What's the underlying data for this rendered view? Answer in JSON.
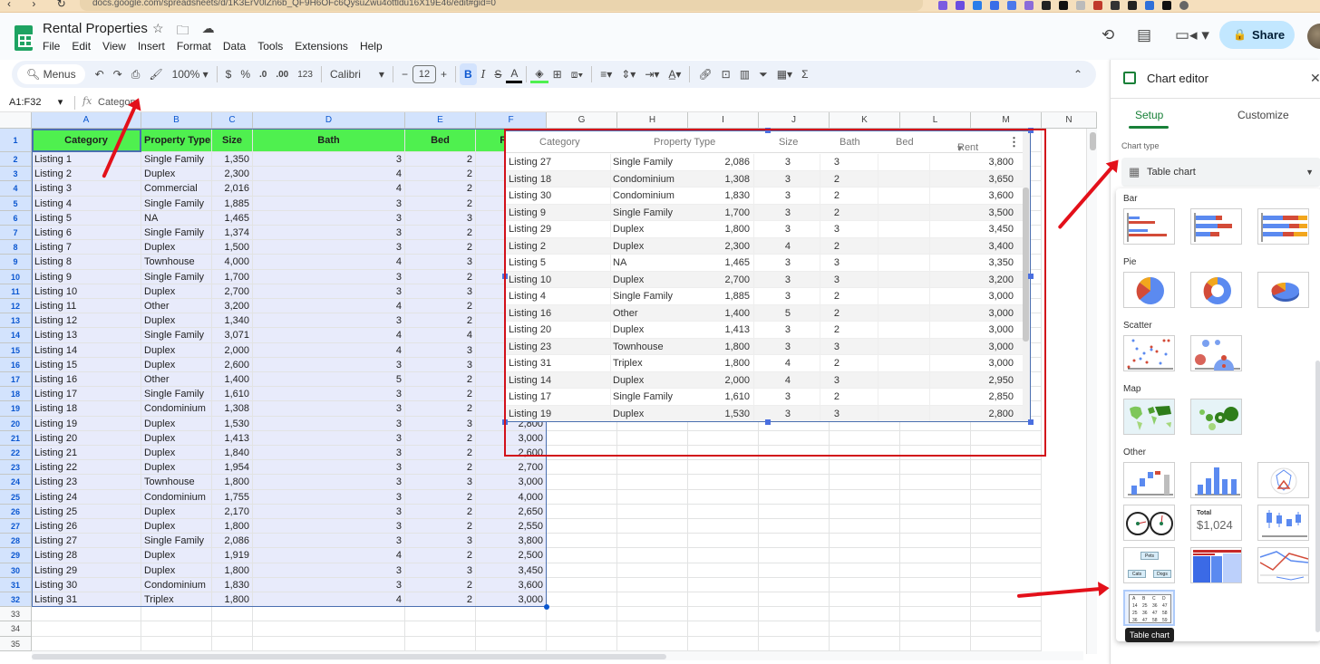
{
  "browser": {
    "url": "docs.google.com/spreadsheets/d/1K3ErV0lZn6b_QF9H6OFc6QysuZwu4ottldu16X19E46/edit#gid=0"
  },
  "app": {
    "title": "Rental Properties",
    "menu": [
      "File",
      "Edit",
      "View",
      "Insert",
      "Format",
      "Data",
      "Tools",
      "Extensions",
      "Help"
    ],
    "share_label": "Share"
  },
  "toolbar": {
    "search_label": "Menus",
    "zoom": "100%",
    "currency": "$",
    "percent": "%",
    "decrease_decimal": ".0",
    "increase_decimal": ".00",
    "number_format": "123",
    "font": "Calibri",
    "font_size": "12",
    "minus": "−",
    "plus": "+",
    "bold": "B",
    "italic": "I",
    "text_color": "A",
    "sum": "Σ"
  },
  "formula_bar": {
    "range": "A1:F32",
    "fx": "fx",
    "value": "Category"
  },
  "sheet": {
    "columns": [
      "A",
      "B",
      "C",
      "D",
      "E",
      "F",
      "G",
      "H",
      "I",
      "J",
      "K",
      "L",
      "M",
      "N"
    ],
    "headers": [
      "Category",
      "Property Type",
      "Size",
      "Bath",
      "Bed",
      "Rent"
    ],
    "rows": [
      [
        "Listing 1",
        "Single Family",
        "1,350",
        "3",
        "2",
        ""
      ],
      [
        "Listing 2",
        "Duplex",
        "2,300",
        "4",
        "2",
        ""
      ],
      [
        "Listing 3",
        "Commercial",
        "2,016",
        "4",
        "2",
        ""
      ],
      [
        "Listing 4",
        "Single Family",
        "1,885",
        "3",
        "2",
        ""
      ],
      [
        "Listing 5",
        "NA",
        "1,465",
        "3",
        "3",
        ""
      ],
      [
        "Listing 6",
        "Single Family",
        "1,374",
        "3",
        "2",
        ""
      ],
      [
        "Listing 7",
        "Duplex",
        "1,500",
        "3",
        "2",
        ""
      ],
      [
        "Listing 8",
        "Townhouse",
        "4,000",
        "4",
        "3",
        ""
      ],
      [
        "Listing 9",
        "Single Family",
        "1,700",
        "3",
        "2",
        ""
      ],
      [
        "Listing 10",
        "Duplex",
        "2,700",
        "3",
        "3",
        ""
      ],
      [
        "Listing 11",
        "Other",
        "3,200",
        "4",
        "2",
        ""
      ],
      [
        "Listing 12",
        "Duplex",
        "1,340",
        "3",
        "2",
        ""
      ],
      [
        "Listing 13",
        "Single Family",
        "3,071",
        "4",
        "4",
        ""
      ],
      [
        "Listing 14",
        "Duplex",
        "2,000",
        "4",
        "3",
        ""
      ],
      [
        "Listing 15",
        "Duplex",
        "2,600",
        "3",
        "3",
        ""
      ],
      [
        "Listing 16",
        "Other",
        "1,400",
        "5",
        "2",
        ""
      ],
      [
        "Listing 17",
        "Single Family",
        "1,610",
        "3",
        "2",
        ""
      ],
      [
        "Listing 18",
        "Condominium",
        "1,308",
        "3",
        "2",
        ""
      ],
      [
        "Listing 19",
        "Duplex",
        "1,530",
        "3",
        "3",
        "2,800"
      ],
      [
        "Listing 20",
        "Duplex",
        "1,413",
        "3",
        "2",
        "3,000"
      ],
      [
        "Listing 21",
        "Duplex",
        "1,840",
        "3",
        "2",
        "2,600"
      ],
      [
        "Listing 22",
        "Duplex",
        "1,954",
        "3",
        "2",
        "2,700"
      ],
      [
        "Listing 23",
        "Townhouse",
        "1,800",
        "3",
        "3",
        "3,000"
      ],
      [
        "Listing 24",
        "Condominium",
        "1,755",
        "3",
        "2",
        "4,000"
      ],
      [
        "Listing 25",
        "Duplex",
        "2,170",
        "3",
        "2",
        "2,650"
      ],
      [
        "Listing 26",
        "Duplex",
        "1,800",
        "3",
        "2",
        "2,550"
      ],
      [
        "Listing 27",
        "Single Family",
        "2,086",
        "3",
        "3",
        "3,800"
      ],
      [
        "Listing 28",
        "Duplex",
        "1,919",
        "4",
        "2",
        "2,500"
      ],
      [
        "Listing 29",
        "Duplex",
        "1,800",
        "3",
        "3",
        "3,450"
      ],
      [
        "Listing 30",
        "Condominium",
        "1,830",
        "3",
        "2",
        "3,600"
      ],
      [
        "Listing 31",
        "Triplex",
        "1,800",
        "4",
        "2",
        "3,000"
      ]
    ],
    "empty_rows": [
      "33",
      "34",
      "35"
    ]
  },
  "table_chart": {
    "headers": [
      "Category",
      "Property Type",
      "Size",
      "Bath",
      "Bed",
      "Rent"
    ],
    "sort_indicator": "Rent descending",
    "rows": [
      [
        "Listing 27",
        "Single Family",
        "2,086",
        "3",
        "3",
        "3,800"
      ],
      [
        "Listing 18",
        "Condominium",
        "1,308",
        "3",
        "2",
        "3,650"
      ],
      [
        "Listing 30",
        "Condominium",
        "1,830",
        "3",
        "2",
        "3,600"
      ],
      [
        "Listing 9",
        "Single Family",
        "1,700",
        "3",
        "2",
        "3,500"
      ],
      [
        "Listing 29",
        "Duplex",
        "1,800",
        "3",
        "3",
        "3,450"
      ],
      [
        "Listing 2",
        "Duplex",
        "2,300",
        "4",
        "2",
        "3,400"
      ],
      [
        "Listing 5",
        "NA",
        "1,465",
        "3",
        "3",
        "3,350"
      ],
      [
        "Listing 10",
        "Duplex",
        "2,700",
        "3",
        "3",
        "3,200"
      ],
      [
        "Listing 4",
        "Single Family",
        "1,885",
        "3",
        "2",
        "3,000"
      ],
      [
        "Listing 16",
        "Other",
        "1,400",
        "5",
        "2",
        "3,000"
      ],
      [
        "Listing 20",
        "Duplex",
        "1,413",
        "3",
        "2",
        "3,000"
      ],
      [
        "Listing 23",
        "Townhouse",
        "1,800",
        "3",
        "3",
        "3,000"
      ],
      [
        "Listing 31",
        "Triplex",
        "1,800",
        "4",
        "2",
        "3,000"
      ],
      [
        "Listing 14",
        "Duplex",
        "2,000",
        "4",
        "3",
        "2,950"
      ],
      [
        "Listing 17",
        "Single Family",
        "1,610",
        "3",
        "2",
        "2,850"
      ],
      [
        "Listing 19",
        "Duplex",
        "1,530",
        "3",
        "3",
        "2,800"
      ]
    ]
  },
  "chart_editor": {
    "title": "Chart editor",
    "tabs": [
      "Setup",
      "Customize"
    ],
    "active_tab": "Setup",
    "chart_type_label": "Chart type",
    "chart_type_value": "Table chart",
    "groups": [
      "Bar",
      "Pie",
      "Scatter",
      "Map",
      "Other"
    ],
    "scorecard_label": "Total",
    "scorecard_value": "$1,024",
    "org_nodes": [
      "Pets",
      "Cats",
      "Dogs"
    ],
    "table_thumb": [
      [
        "A",
        "B",
        "C",
        "D"
      ],
      [
        "14",
        "25",
        "36",
        "47"
      ],
      [
        "25",
        "36",
        "47",
        "58"
      ],
      [
        "36",
        "47",
        "58",
        "59"
      ]
    ],
    "tooltip": "Table chart"
  },
  "colors": {
    "header_fill": "#4ff04f",
    "selection_fill": "#e8ebfb",
    "accent_green": "#188038",
    "share_bg": "#c2e7ff",
    "annotation_red": "#e3101a"
  }
}
